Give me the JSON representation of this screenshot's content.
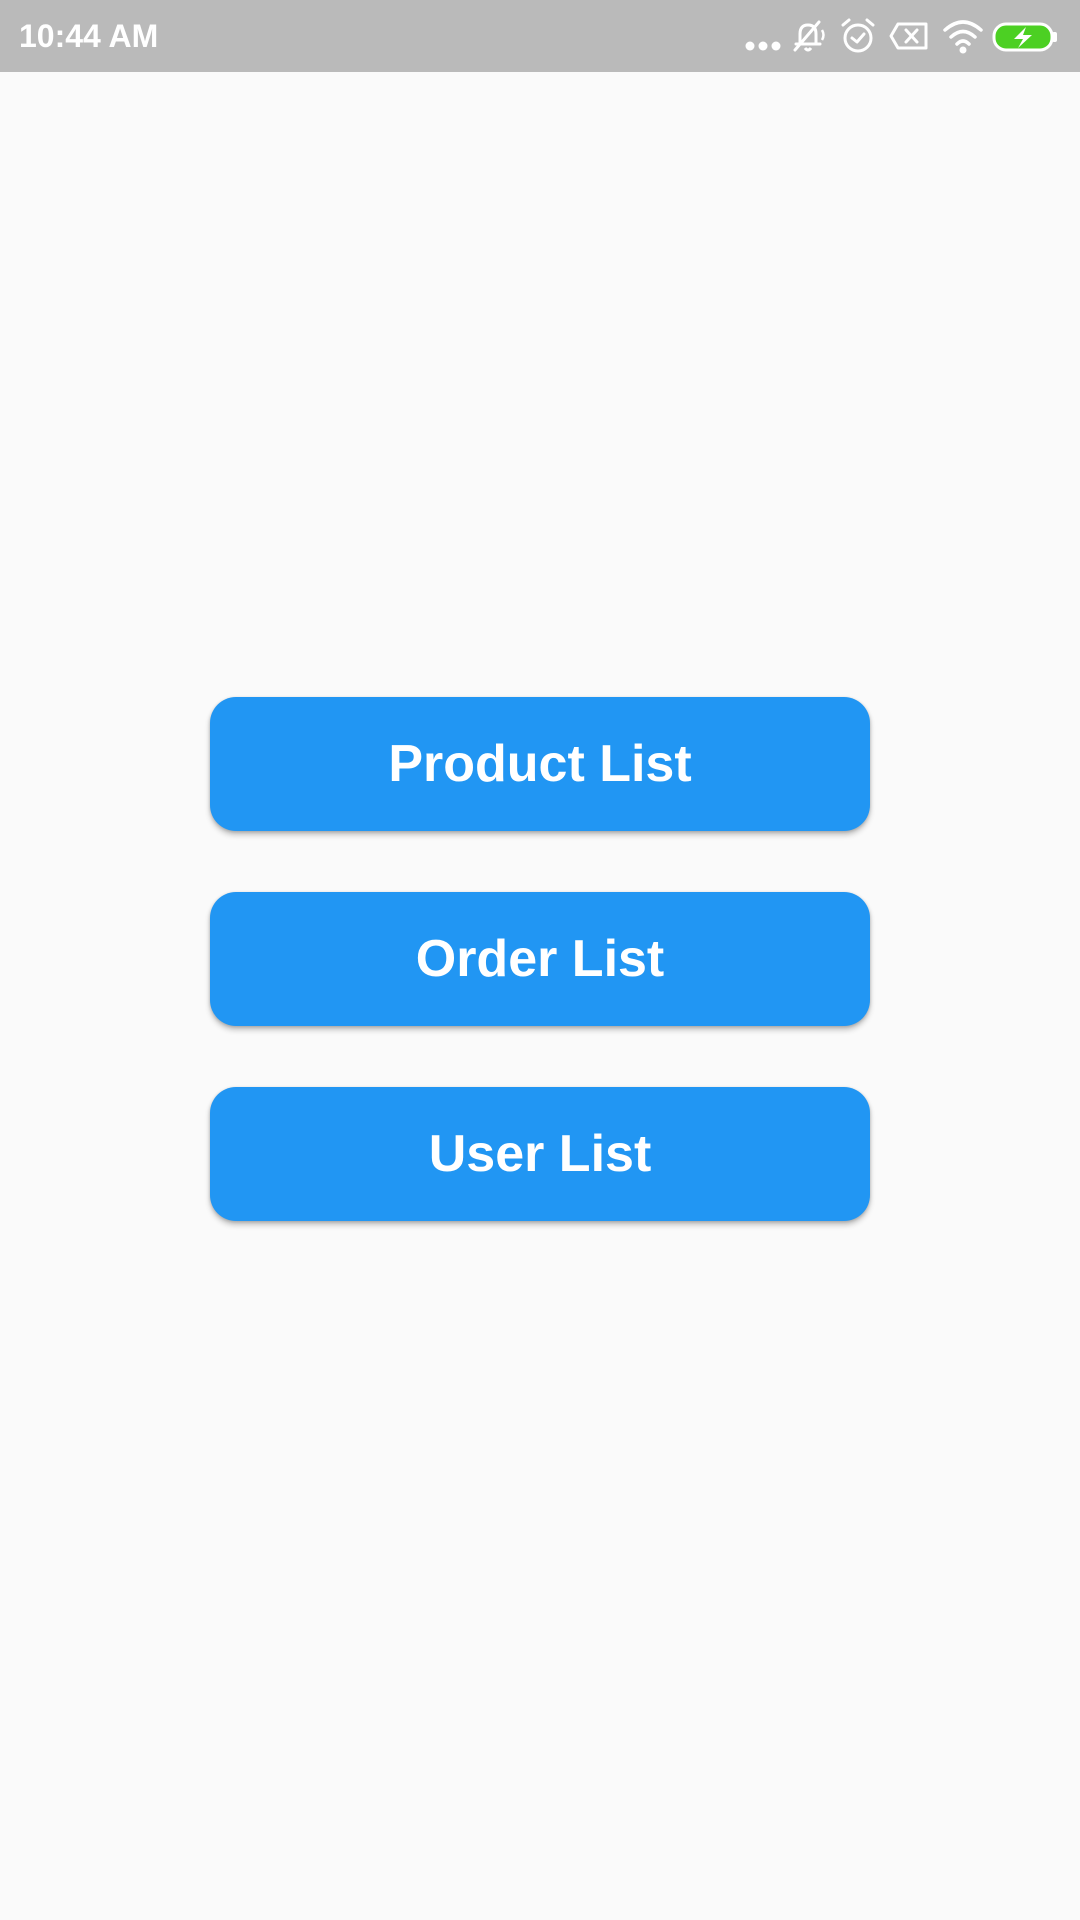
{
  "status_bar": {
    "time": "10:44 AM",
    "icons": [
      "more-dots-icon",
      "notifications-off-icon",
      "alarm-icon",
      "sim-card-x-icon",
      "wifi-icon",
      "battery-charging-icon"
    ],
    "colors": {
      "background": "#bababa",
      "foreground": "#ffffff",
      "battery_fill": "#4cd023"
    }
  },
  "main": {
    "buttons": [
      {
        "label": "Product List"
      },
      {
        "label": "Order List"
      },
      {
        "label": "User List"
      }
    ],
    "colors": {
      "background": "#fafafa",
      "button": "#2196f3",
      "button_text": "#ffffff"
    }
  }
}
